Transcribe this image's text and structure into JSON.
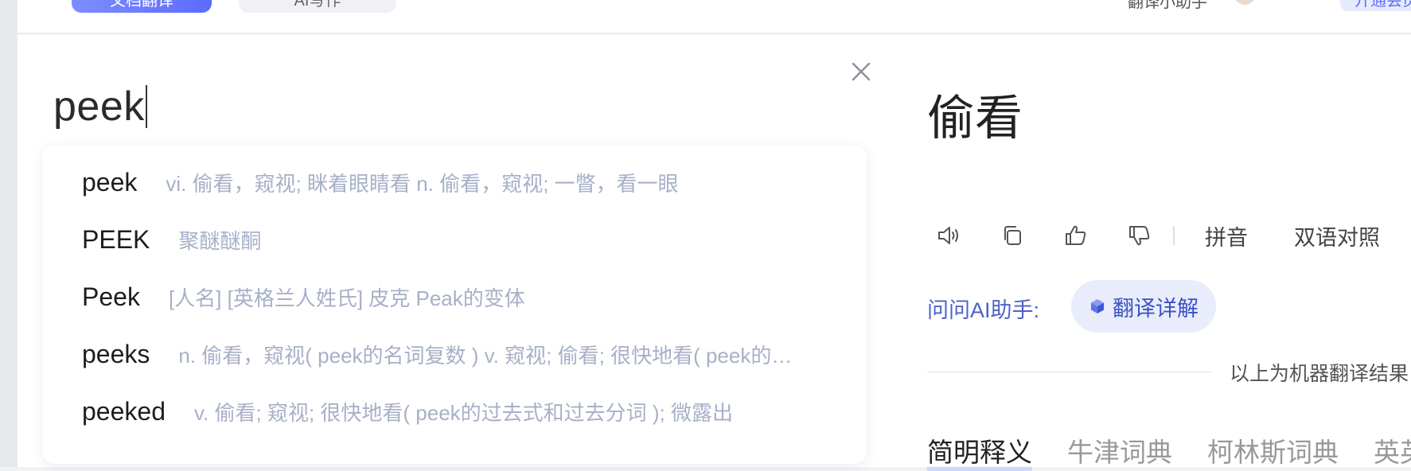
{
  "topbar": {
    "primary_button": "文档翻译",
    "secondary_button": "AI写作",
    "user_name": "翻译小助手",
    "pill_button": "开通会员"
  },
  "search": {
    "query": "peek"
  },
  "suggestions": [
    {
      "word": "peek",
      "definition": "vi. 偷看，窥视; 眯着眼睛看 n. 偷看，窥视; 一瞥，看一眼"
    },
    {
      "word": "PEEK",
      "definition": "聚醚醚酮"
    },
    {
      "word": "Peek",
      "definition": "[人名] [英格兰人姓氏] 皮克 Peak的变体"
    },
    {
      "word": "peeks",
      "definition": "n. 偷看，窥视( peek的名词复数 ) v. 窥视; 偷看; 很快地看( peek的…"
    },
    {
      "word": "peeked",
      "definition": "v. 偷看; 窥视; 很快地看( peek的过去式和过去分词 ); 微露出"
    }
  ],
  "result": {
    "translation": "偷看",
    "tools": {
      "pinyin": "拼音",
      "bilingual": "双语对照"
    },
    "ai": {
      "label": "问问AI助手:",
      "chip": "翻译详解"
    },
    "note": "以上为机器翻译结果"
  },
  "dict_tabs": [
    "简明释义",
    "牛津词典",
    "柯林斯词典",
    "英英词典"
  ],
  "colors": {
    "accent": "#5b6cff",
    "ai_text": "#3c52c4",
    "suggestion_def": "#a8b0c8"
  }
}
